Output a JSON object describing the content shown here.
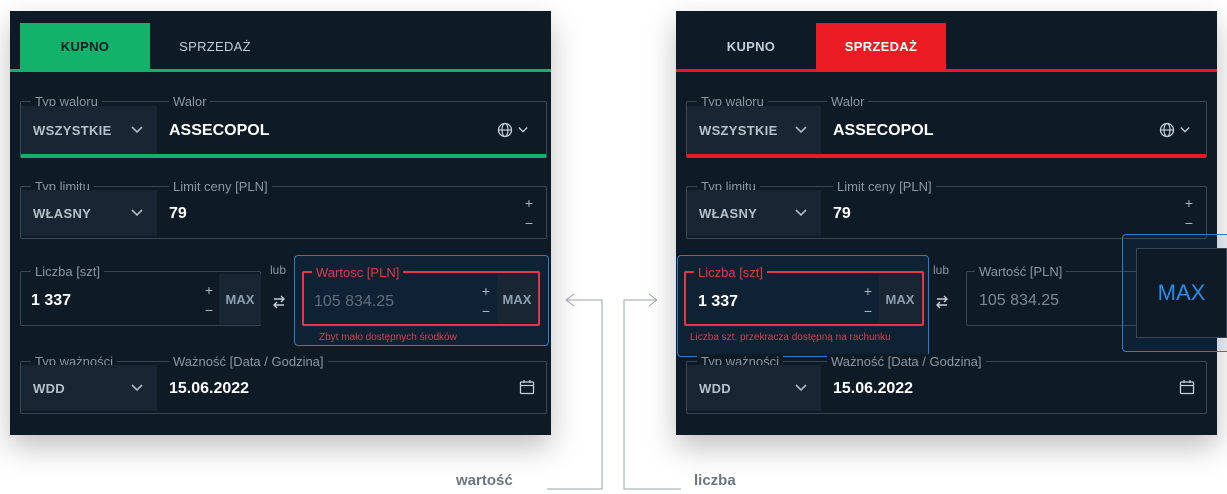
{
  "left": {
    "tabs": {
      "buy": "KUPNO",
      "sell": "SPRZEDAŻ"
    },
    "typ_waloru": {
      "label": "Typ waloru",
      "value": "WSZYSTKIE"
    },
    "walor": {
      "label": "Walor",
      "value": "ASSECOPOL"
    },
    "typ_limitu": {
      "label": "Typ limitu",
      "value": "WŁASNY"
    },
    "limit_ceny": {
      "label": "Limit ceny [PLN]",
      "value": "79",
      "plus": "+",
      "minus": "−"
    },
    "liczba": {
      "label": "Liczba [szt]",
      "value": "1 337",
      "plus": "+",
      "minus": "−",
      "max": "MAX"
    },
    "lub": "lub",
    "wartosc": {
      "label": "Wartosc [PLN]",
      "value": "105 834.25",
      "plus": "+",
      "minus": "−",
      "max": "MAX",
      "error": "Zbyt mało dostępnych środków"
    },
    "typ_waznosci": {
      "label": "Typ ważności",
      "value": "WDD"
    },
    "waznosc": {
      "label": "Ważność [Data / Godzina]",
      "value": "15.06.2022"
    }
  },
  "right": {
    "tabs": {
      "buy": "KUPNO",
      "sell": "SPRZEDAŻ"
    },
    "typ_waloru": {
      "label": "Typ waloru",
      "value": "WSZYSTKIE"
    },
    "walor": {
      "label": "Walor",
      "value": "ASSECOPOL"
    },
    "typ_limitu": {
      "label": "Typ limitu",
      "value": "WŁASNY"
    },
    "limit_ceny": {
      "label": "Limit ceny [PLN]",
      "value": "79",
      "plus": "+",
      "minus": "−"
    },
    "liczba": {
      "label": "Liczba [szt]",
      "value": "1 337",
      "plus": "+",
      "minus": "−",
      "max": "MAX",
      "error": "Liczba szt. przekracza dostępną na rachunku"
    },
    "lub": "lub",
    "wartosc": {
      "label": "Wartość [PLN]",
      "value": "105 834.25"
    },
    "max_callout": "MAX",
    "typ_waznosci": {
      "label": "Typ ważności",
      "value": "WDD"
    },
    "waznosc": {
      "label": "Ważność [Data / Godzina]",
      "value": "15.06.2022"
    }
  },
  "annotations": {
    "wartosc": "wartość",
    "liczba": "liczba"
  },
  "colors": {
    "buy_green": "#13b26b",
    "sell_red": "#ea1b23",
    "error_red": "#e2394a",
    "highlight_blue": "#2b7bd1",
    "panel_bg": "#0e1b26"
  },
  "icons": [
    "chevron-down-icon",
    "globe-icon",
    "swap-arrows-icon",
    "calendar-icon"
  ]
}
